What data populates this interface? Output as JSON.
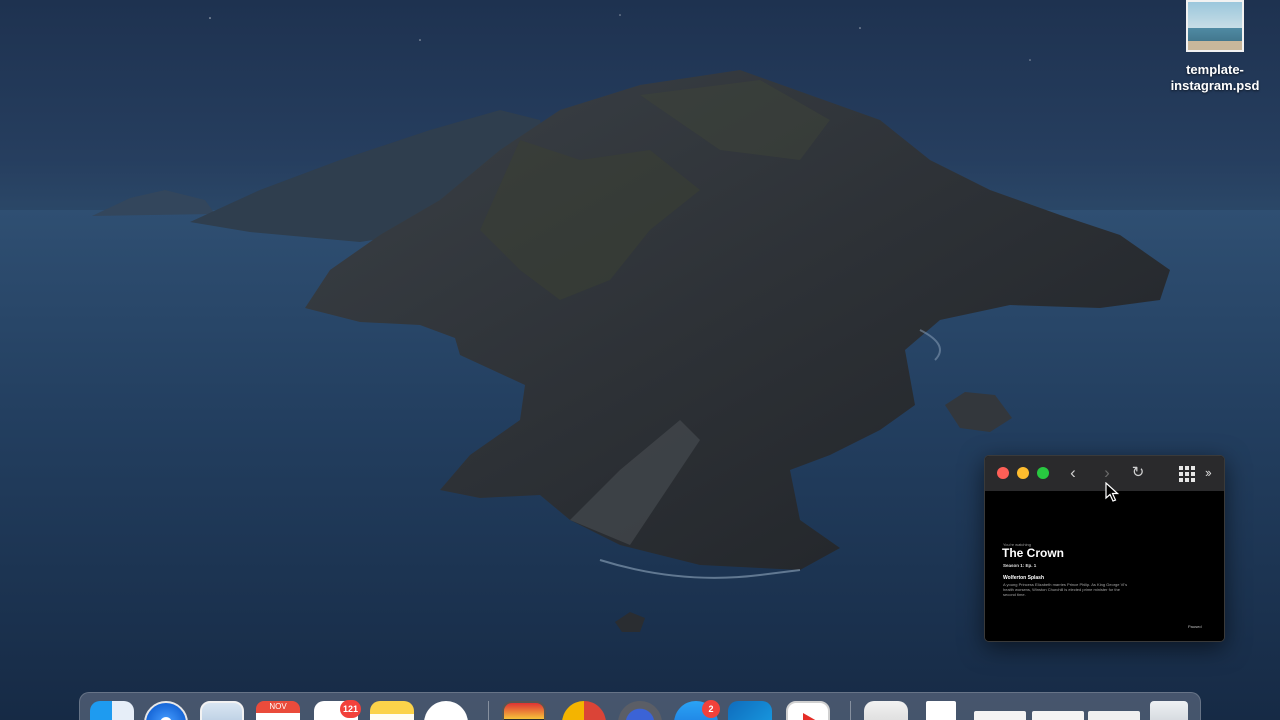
{
  "desktop": {
    "file": {
      "name": "template-instagram.psd"
    }
  },
  "pip": {
    "toolbar": {
      "back_glyph": "‹",
      "forward_glyph": "›",
      "reload_glyph": "↻",
      "more_glyph": "››"
    },
    "content": {
      "watching": "You're watching",
      "title": "The Crown",
      "episode": "Season 1: Ep. 1",
      "episode_name": "Wolferton Splash",
      "description": "A young Princess Elizabeth marries Prince Philip. As King George VI's health worsens, Winston Churchill is elected prime minister for the second time.",
      "status": "Paused"
    }
  },
  "dock": {
    "items": [
      {
        "name": "Finder",
        "icon": "finder-icon"
      },
      {
        "name": "Safari",
        "icon": "safari-icon"
      },
      {
        "name": "Mail",
        "icon": "mail-icon"
      },
      {
        "name": "Calendar",
        "icon": "calendar-icon",
        "month": "NOV"
      },
      {
        "name": "Reminders",
        "icon": "reminders-icon",
        "badge": "121"
      },
      {
        "name": "Notes",
        "icon": "notes-icon"
      },
      {
        "name": "Slack",
        "icon": "slack-icon"
      },
      {
        "name": "Photo Booth",
        "icon": "photobooth-icon"
      },
      {
        "name": "Chrome",
        "icon": "chrome-icon"
      },
      {
        "name": "Screen Recorder",
        "icon": "recorder-icon"
      },
      {
        "name": "Xcode",
        "icon": "xcode-icon",
        "badge": "2"
      },
      {
        "name": "Outlook",
        "icon": "outlook-icon"
      },
      {
        "name": "YouTube",
        "icon": "youtube-icon"
      },
      {
        "name": "Preview",
        "icon": "preview-icon"
      },
      {
        "name": "Document",
        "icon": "document-icon"
      },
      {
        "name": "Window 1",
        "icon": "window-thumb-icon"
      },
      {
        "name": "Window 2",
        "icon": "window-thumb-icon"
      },
      {
        "name": "Window 3",
        "icon": "window-thumb-icon"
      },
      {
        "name": "Trash",
        "icon": "trash-icon"
      }
    ]
  },
  "colors": {
    "traffic_red": "#fe5f57",
    "traffic_yellow": "#febc2e",
    "traffic_green": "#28c840",
    "badge_red": "#f2413b"
  }
}
